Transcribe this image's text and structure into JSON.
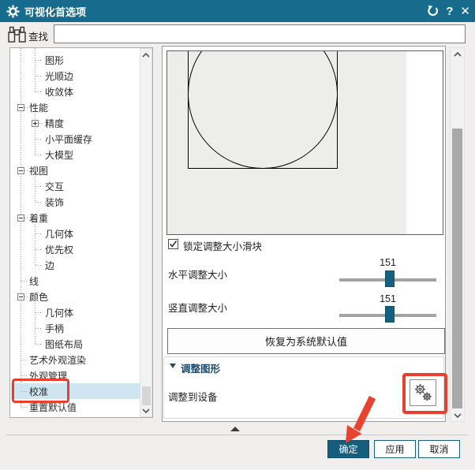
{
  "window": {
    "title": "可视化首选项",
    "help_glyph": "?",
    "close_glyph": "✕",
    "icons": [
      "gear-icon",
      "reset-icon",
      "help-icon",
      "close-icon"
    ]
  },
  "search": {
    "label": "查找",
    "value": "",
    "icon": "binoculars-icon"
  },
  "tree": {
    "items": [
      {
        "label": "图形",
        "level": 2,
        "expand": "none"
      },
      {
        "label": "光顺边",
        "level": 2,
        "expand": "none"
      },
      {
        "label": "收敛体",
        "level": 2,
        "expand": "none"
      },
      {
        "label": "性能",
        "level": 1,
        "expand": "minus"
      },
      {
        "label": "精度",
        "level": 2,
        "expand": "plus"
      },
      {
        "label": "小平面缓存",
        "level": 2,
        "expand": "none"
      },
      {
        "label": "大模型",
        "level": 2,
        "expand": "none"
      },
      {
        "label": "视图",
        "level": 1,
        "expand": "minus"
      },
      {
        "label": "交互",
        "level": 2,
        "expand": "none"
      },
      {
        "label": "装饰",
        "level": 2,
        "expand": "none"
      },
      {
        "label": "着重",
        "level": 1,
        "expand": "minus"
      },
      {
        "label": "几何体",
        "level": 2,
        "expand": "none"
      },
      {
        "label": "优先权",
        "level": 2,
        "expand": "none"
      },
      {
        "label": "边",
        "level": 2,
        "expand": "none"
      },
      {
        "label": "线",
        "level": 1,
        "expand": "none"
      },
      {
        "label": "颜色",
        "level": 1,
        "expand": "minus"
      },
      {
        "label": "几何体",
        "level": 2,
        "expand": "none"
      },
      {
        "label": "手柄",
        "level": 2,
        "expand": "none"
      },
      {
        "label": "图纸布局",
        "level": 2,
        "expand": "none"
      },
      {
        "label": "艺术外观渲染",
        "level": 1,
        "expand": "none"
      },
      {
        "label": "外观管理",
        "level": 1,
        "expand": "none"
      },
      {
        "label": "校准",
        "level": 1,
        "expand": "none",
        "selected": true,
        "annotated": true
      },
      {
        "label": "重置默认值",
        "level": 1,
        "expand": "none"
      }
    ]
  },
  "content": {
    "preview": {
      "shapes": [
        "square",
        "inscribed-circle"
      ]
    },
    "checkbox": {
      "label": "锁定调整大小滑块",
      "checked": true
    },
    "sliders": [
      {
        "label": "水平调整大小",
        "value": "151"
      },
      {
        "label": "竖直调整大小",
        "value": "151"
      }
    ],
    "restore_button": "恢复为系统默认值",
    "group": {
      "title": "调整图形",
      "collapse_icon": "triangle-down",
      "row_label": "调整到设备",
      "button_icon": "double-gear-icon",
      "annotated": true
    }
  },
  "footer": {
    "ok": "确定",
    "apply": "应用",
    "cancel": "取消",
    "collapse_icon": "triangle-up"
  },
  "annotations": {
    "arrow": "red-arrow-pointing-to-ok",
    "highlight_color": "#e8402d"
  },
  "colors": {
    "titlebar": "#176b8c",
    "accent": "#17607f",
    "ok_button": "#175d7d",
    "tree_selection": "#cfe6f0",
    "annotation_red": "#e8402d",
    "slider_thumb": "#16607f"
  }
}
